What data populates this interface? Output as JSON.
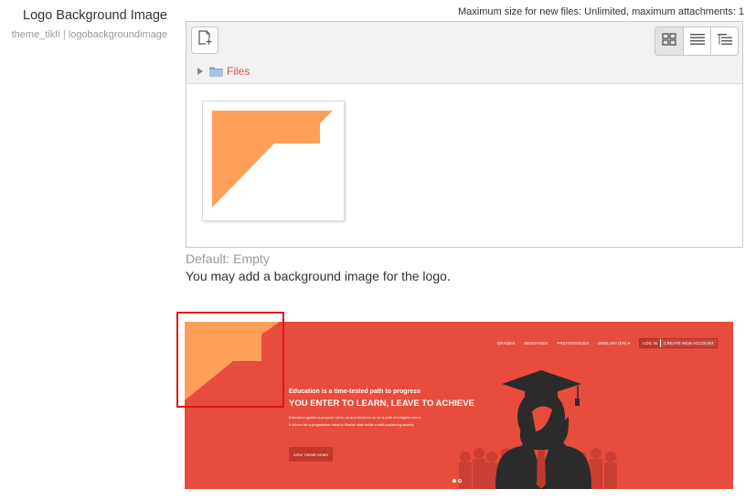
{
  "setting": {
    "title": "Logo Background Image",
    "subtitle": "theme_tiklí | logobackgroundimage"
  },
  "filemanager": {
    "max_size_text": "Maximum size for new files: Unlimited, maximum attachments: 1",
    "path_label": "Files",
    "icons": {
      "add": "add-file-icon",
      "view_icons": "grid-view-icon",
      "view_details": "list-view-icon",
      "view_tree": "tree-view-icon",
      "folder": "folder-icon"
    }
  },
  "description": {
    "default": "Default: Empty",
    "text": "You may add a background image for the logo."
  },
  "preview": {
    "nav": [
      "GRADES",
      "MESSAGES",
      "PREFERENCES",
      "ENGLISH (EN) ▾"
    ],
    "login": "LOG IN",
    "create_account": "CREATE NEW ACCOUNT",
    "heading_small": "Education is a time-tested path to progress",
    "heading_large": "YOU ENTER TO LEARN, LEAVE TO ACHIEVE",
    "para_line1": "Education ignites a purpose within us and beckons us on a path of enlightenment.",
    "para_line2": "It allows for a progressive mind to flourish that builds a self-sustaining society.",
    "button": "VIEW THEME DEMO",
    "colors": {
      "bg": "#e84c3d",
      "logo": "#ffa05a",
      "silhouette": "#2b2b2b"
    }
  },
  "colors": {
    "accent": "#d9534f",
    "highlight": "#e1141b",
    "logo_orange": "#ffa05a"
  }
}
